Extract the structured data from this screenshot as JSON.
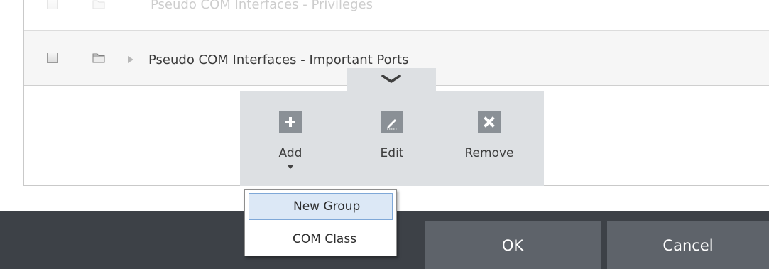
{
  "list": {
    "rows": [
      {
        "label": "Pseudo COM Interfaces - Privileges",
        "checked": false
      },
      {
        "label": "Pseudo COM Interfaces - Important Ports",
        "checked": false
      }
    ]
  },
  "toolbar": {
    "add_label": "Add",
    "edit_label": "Edit",
    "remove_label": "Remove"
  },
  "add_menu": {
    "items": [
      "New Group",
      "COM Class"
    ],
    "highlighted": "New Group"
  },
  "footer": {
    "ok_label": "OK",
    "cancel_label": "Cancel"
  },
  "colors": {
    "toolbar_bg": "#dde0e3",
    "icon_bg": "#8a9096",
    "footer_bg": "#3d4147",
    "button_bg": "#5e636a",
    "menu_highlight": "#dce8f6"
  }
}
